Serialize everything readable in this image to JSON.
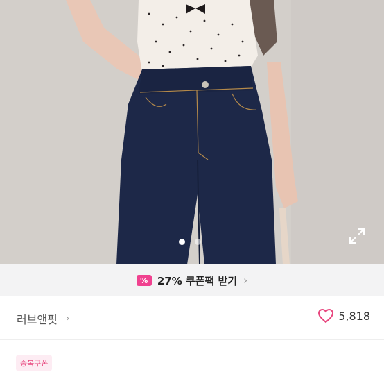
{
  "product_image": {
    "description_icon": "product-photo",
    "carousel": {
      "total": 2,
      "active_index": 0
    },
    "expand_icon": "expand-icon"
  },
  "coupon_bar": {
    "icon": "percent-coupon-icon",
    "icon_glyph": "%",
    "label": "27% 쿠폰팩 받기",
    "chevron": "›"
  },
  "seller": {
    "name": "러브앤핏",
    "chevron": "›"
  },
  "likes": {
    "icon": "heart-icon",
    "count": "5,818",
    "color": "#e8467e"
  },
  "badge": {
    "label": "중복쿠폰"
  },
  "accent_color": "#f0418f"
}
